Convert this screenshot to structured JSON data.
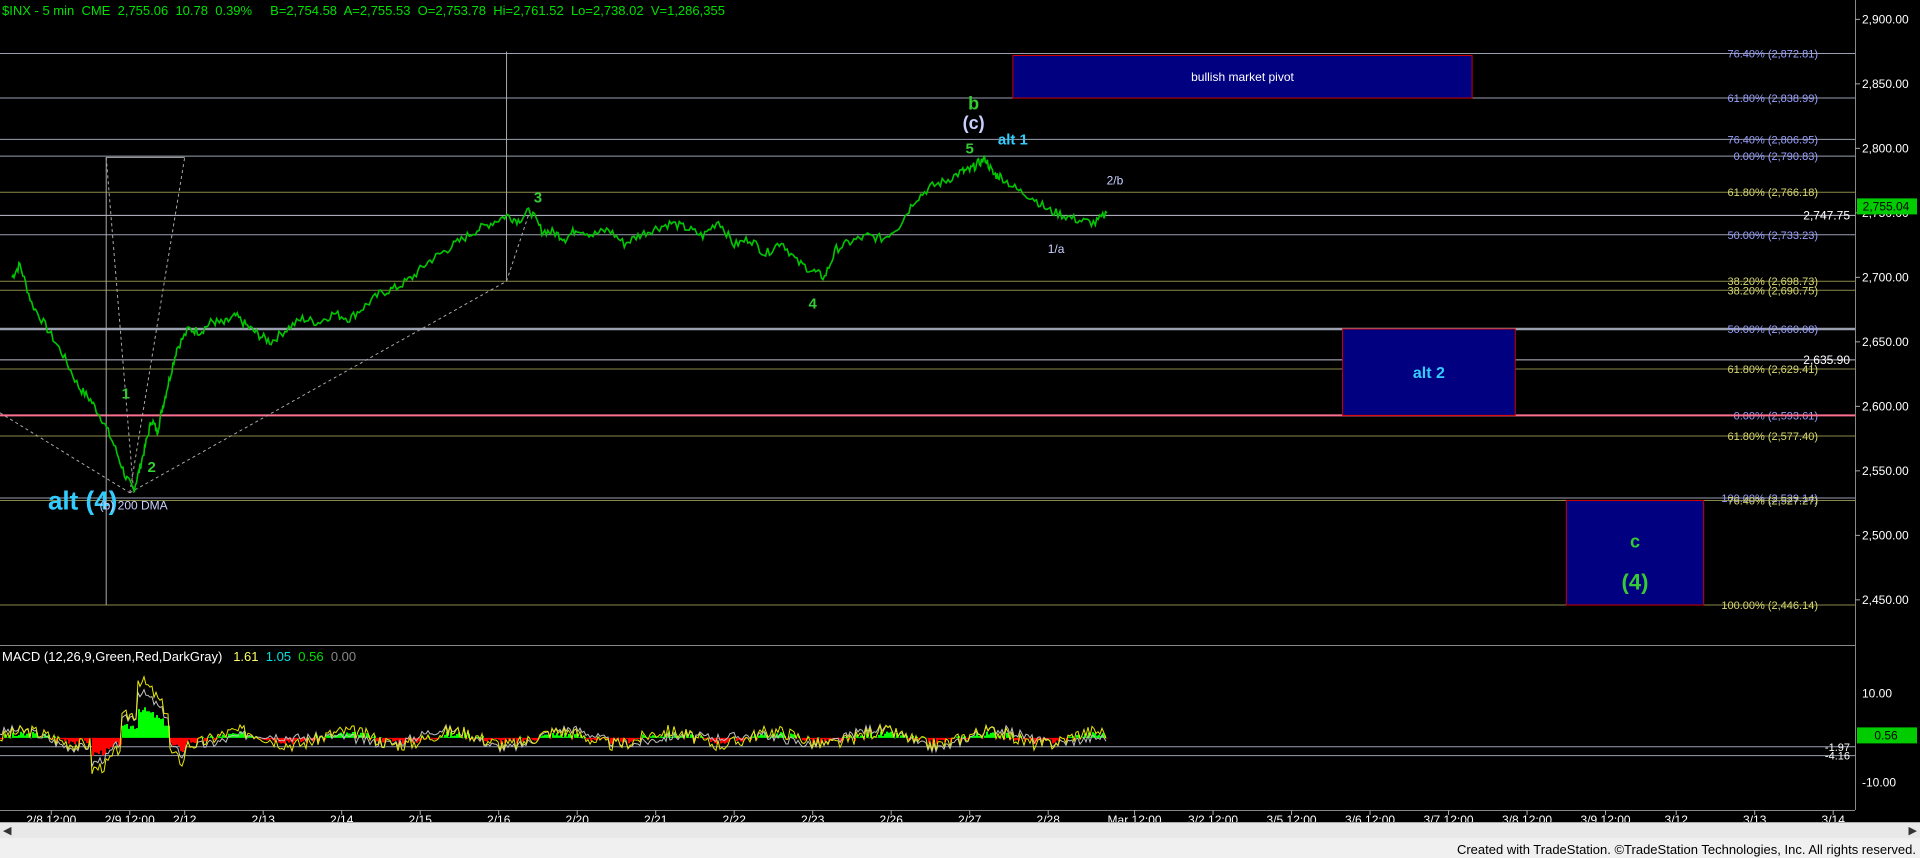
{
  "header": {
    "symbol": "$INX - 5 min",
    "exchange": "CME",
    "last": "2,755.06",
    "change": "10.78",
    "pct": "0.39%",
    "bid": "B=2,754.58",
    "ask": "A=2,755.53",
    "open": "O=2,753.78",
    "hi": "Hi=2,761.52",
    "lo": "Lo=2,738.02",
    "vol": "V=1,286,355"
  },
  "macd_header": {
    "label": "MACD (12,26,9,Green,Red,DarkGray)",
    "v1": "1.61",
    "v2": "1.05",
    "v3": "0.56",
    "v4": "0.00"
  },
  "credit": "Created with TradeStation. ©TradeStation Technologies, Inc. All rights reserved.",
  "colors": {
    "background": "#000000",
    "price": "#00c800",
    "wave_label": "#33cc33",
    "alt_label": "#33ccff",
    "fib_line": "#8a8a4a",
    "box_fill": "#000080",
    "box_border": "#cc0000",
    "macd_up": "#00ff00",
    "macd_down": "#ff0000",
    "macd_line": "#e8e800",
    "signal_line": "#c0c0c0"
  },
  "chart_data": [
    {
      "type": "line",
      "title": "",
      "ylim": [
        2415,
        2915
      ],
      "y_ticks": [
        "2,900.00",
        "2,850.00",
        "2,800.00",
        "2,750.00",
        "2,700.00",
        "2,650.00",
        "2,600.00",
        "2,550.00",
        "2,500.00",
        "2,450.00"
      ],
      "y_tick_values": [
        2900,
        2850,
        2800,
        2750,
        2700,
        2650,
        2600,
        2550,
        2500,
        2450
      ],
      "x_ticks": [
        "2/8 12:00",
        "2/9 12:00",
        "2/12",
        "2/13",
        "2/14",
        "2/15",
        "2/16",
        "2/20",
        "2/21",
        "2/22",
        "2/23",
        "2/26",
        "2/27",
        "2/28",
        "Mar 12:00",
        "3/2 12:00",
        "3/5 12:00",
        "3/6 12:00",
        "3/7 12:00",
        "3/8 12:00",
        "3/9 12:00",
        "3/12",
        "3/13",
        "3/14"
      ],
      "x_tick_index": [
        0.5,
        1.5,
        2.2,
        3.2,
        4.2,
        5.2,
        6.2,
        7.2,
        8.2,
        9.2,
        10.2,
        11.2,
        12.2,
        13.2,
        14.3,
        15.3,
        16.3,
        17.3,
        18.3,
        19.3,
        20.3,
        21.2,
        22.2,
        23.2
      ],
      "price_series": {
        "name": "$INX",
        "t": [
          0,
          0.1,
          0.25,
          0.45,
          0.65,
          0.85,
          1.0,
          1.15,
          1.3,
          1.45,
          1.55,
          1.62,
          1.7,
          1.78,
          1.85,
          1.92,
          2.0,
          2.1,
          2.25,
          2.4,
          2.55,
          2.7,
          2.85,
          3.0,
          3.15,
          3.3,
          3.5,
          3.7,
          3.9,
          4.1,
          4.3,
          4.5,
          4.7,
          4.9,
          5.1,
          5.3,
          5.5,
          5.7,
          5.9,
          6.1,
          6.3,
          6.45,
          6.6,
          6.75,
          6.9,
          7.05,
          7.2,
          7.4,
          7.6,
          7.8,
          8.0,
          8.2,
          8.4,
          8.6,
          8.8,
          9.0,
          9.2,
          9.4,
          9.6,
          9.8,
          10.0,
          10.2,
          10.35,
          10.5,
          10.7,
          10.9,
          11.1,
          11.3,
          11.5,
          11.7,
          11.9,
          12.1,
          12.2,
          12.3,
          12.4,
          12.5,
          12.6,
          12.8,
          13.0,
          13.2,
          13.4,
          13.6,
          13.8,
          13.95
        ],
        "y": [
          2700,
          2710,
          2680,
          2660,
          2640,
          2615,
          2605,
          2590,
          2570,
          2545,
          2535,
          2550,
          2570,
          2590,
          2580,
          2600,
          2620,
          2645,
          2660,
          2658,
          2666,
          2664,
          2670,
          2662,
          2655,
          2650,
          2660,
          2668,
          2665,
          2672,
          2668,
          2678,
          2688,
          2692,
          2700,
          2712,
          2720,
          2728,
          2736,
          2742,
          2748,
          2744,
          2752,
          2736,
          2735,
          2730,
          2738,
          2733,
          2737,
          2726,
          2733,
          2738,
          2742,
          2738,
          2732,
          2744,
          2725,
          2730,
          2718,
          2728,
          2712,
          2705,
          2700,
          2722,
          2728,
          2732,
          2730,
          2740,
          2760,
          2770,
          2775,
          2782,
          2783,
          2788,
          2792,
          2780,
          2778,
          2768,
          2762,
          2752,
          2748,
          2744,
          2742,
          2750
        ]
      },
      "fib_levels": [
        {
          "label": "76.40% (2,872.81)",
          "value": 2873.5
        },
        {
          "label": "61.80% (2,838.99)",
          "value": 2839
        },
        {
          "label": "76.40% (2,806.95)",
          "value": 2807
        },
        {
          "label": "0.00% (2,790.83)",
          "value": 2794
        },
        {
          "label": "61.80% (2,766.18)",
          "value": 2766
        },
        {
          "label": "50.00% (2,733.23)",
          "value": 2733
        },
        {
          "label": "38.20% (2,698.73)",
          "value": 2697
        },
        {
          "label": "38.20% (2,690.75)",
          "value": 2690
        },
        {
          "label": "50.00% (2,660.08)",
          "value": 2660
        },
        {
          "label": "61.80% (2,629.41)",
          "value": 2629
        },
        {
          "label": "0.00% (2,593.61)",
          "value": 2593
        },
        {
          "label": "61.80% (2,577.40)",
          "value": 2577
        },
        {
          "label": "100.00% (2,529.14)",
          "value": 2529
        },
        {
          "label": "76.40% (2,527.27)",
          "value": 2527
        },
        {
          "label": "100.00% (2,446.14)",
          "value": 2446
        }
      ],
      "price_levels": [
        {
          "label": "2,747.75",
          "value": 2748
        },
        {
          "label": "2,635.90",
          "value": 2636
        }
      ],
      "current_price_tag": {
        "label": "2,755.04",
        "value": 2755
      },
      "boxes": [
        {
          "label": "bullish market pivot",
          "t0": 12.75,
          "t1": 18.6,
          "y0": 2839,
          "y1": 2872
        },
        {
          "label": "alt 2",
          "t0": 16.95,
          "t1": 19.15,
          "y0": 2593,
          "y1": 2660
        },
        {
          "label": "c",
          "label2": "(4)",
          "t0": 19.8,
          "t1": 21.55,
          "y0": 2446,
          "y1": 2527
        }
      ],
      "wave_labels": [
        {
          "text": "alt (4)",
          "t": 0.9,
          "y": 2520,
          "color": "alt",
          "size": "big"
        },
        {
          "text": "(b) 200 DMA",
          "t": 1.55,
          "y": 2520,
          "color": "white",
          "size": "small"
        },
        {
          "text": "1",
          "t": 1.45,
          "y": 2606,
          "color": "green",
          "size": "med"
        },
        {
          "text": "2",
          "t": 1.78,
          "y": 2549,
          "color": "green",
          "size": "med"
        },
        {
          "text": "3",
          "t": 6.7,
          "y": 2758,
          "color": "green",
          "size": "med"
        },
        {
          "text": "4",
          "t": 10.2,
          "y": 2676,
          "color": "green",
          "size": "med"
        },
        {
          "text": "5",
          "t": 12.2,
          "y": 2796,
          "color": "green",
          "size": "med"
        },
        {
          "text": "b",
          "t": 12.25,
          "y": 2830,
          "color": "green",
          "size": "big"
        },
        {
          "text": "(c)",
          "t": 12.25,
          "y": 2815,
          "color": "white",
          "size": "big"
        },
        {
          "text": "alt 1",
          "t": 12.75,
          "y": 2803,
          "color": "alt",
          "size": "med"
        },
        {
          "text": "1/a",
          "t": 13.3,
          "y": 2719,
          "color": "white",
          "size": "small"
        },
        {
          "text": "2/b",
          "t": 14.05,
          "y": 2772,
          "color": "white",
          "size": "small"
        }
      ],
      "macd": {
        "y_ticks": [
          "10.00",
          "-10.00"
        ],
        "y_tick_values": [
          10,
          -10
        ],
        "ylim": [
          -14,
          18
        ],
        "right_labels": [
          {
            "label": "-1.97",
            "value": -2
          },
          {
            "label": "-4.16",
            "value": -4
          }
        ],
        "current_tag": {
          "label": "0.56",
          "value": 0.56
        }
      }
    }
  ]
}
